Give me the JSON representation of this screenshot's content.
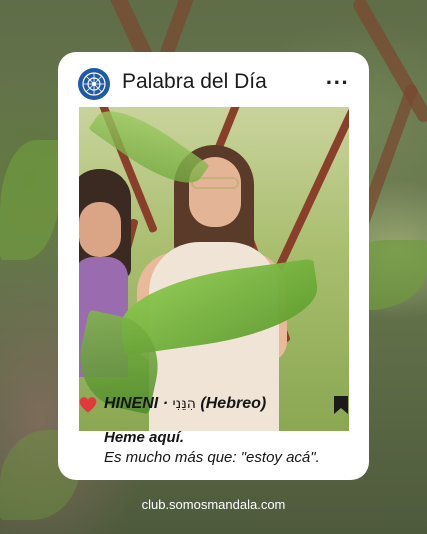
{
  "card": {
    "title": "Palabra del Día",
    "more_label": "...",
    "avatar_icon": "mandala-logo-icon",
    "brand_color": "#1f5aa8"
  },
  "word": {
    "name": "HINENI",
    "separator": "·",
    "hebrew": "הִנֵּנִי",
    "language": "(Hebreo)",
    "heart_icon": "heart-icon",
    "heart_color": "#e03a3a",
    "bookmark_icon": "bookmark-icon"
  },
  "meaning": {
    "title": "Heme aquí.",
    "text": "Es mucho más que: \"estoy acá\"."
  },
  "footer": {
    "url": "club.somosmandala.com"
  }
}
